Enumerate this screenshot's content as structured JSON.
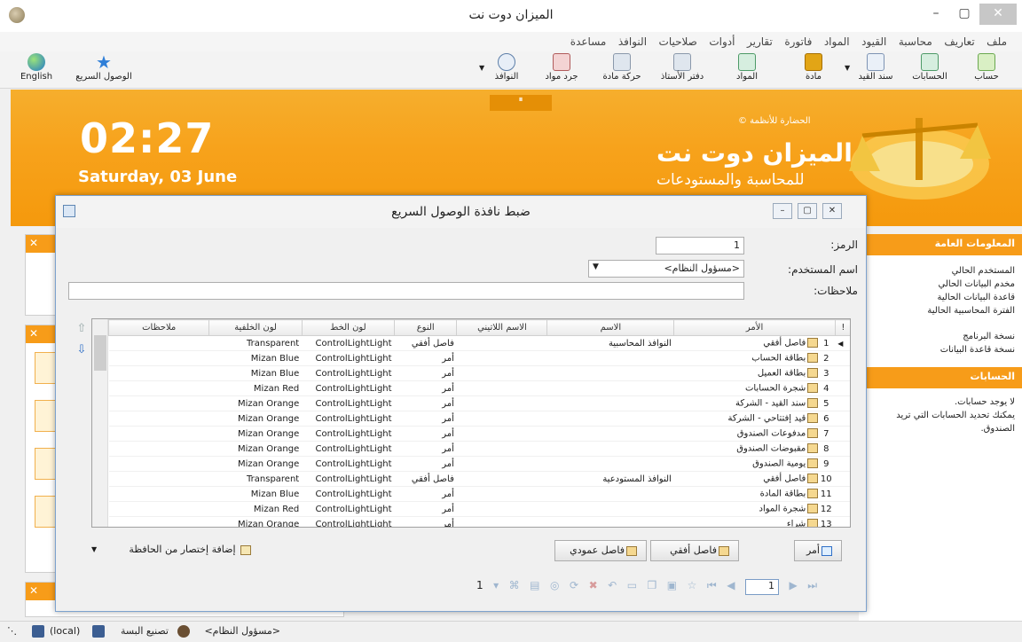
{
  "window": {
    "title": "الميزان دوت نت"
  },
  "menu": [
    "ملف",
    "تعاريف",
    "محاسبة",
    "القيود",
    "المواد",
    "فاتورة",
    "تقارير",
    "أدوات",
    "صلاحيات",
    "النوافذ",
    "مساعدة"
  ],
  "toolbar": {
    "left": [
      {
        "label": "English",
        "icon": "globe-icon"
      },
      {
        "label": "الوصول السريع",
        "icon": "star-icon"
      }
    ],
    "right": [
      {
        "label": "حساب",
        "icon": "account-card-icon"
      },
      {
        "label": "الحسابات",
        "icon": "accounts-tree-icon"
      },
      {
        "label": "سند القيد",
        "icon": "journal-entry-icon"
      },
      {
        "label": "مادة",
        "icon": "material-icon"
      },
      {
        "label": "المواد",
        "icon": "materials-tree-icon"
      },
      {
        "label": "دفتر الأستاذ",
        "icon": "ledger-icon"
      },
      {
        "label": "حركة مادة",
        "icon": "material-movement-icon"
      },
      {
        "label": "جرد مواد",
        "icon": "inventory-icon"
      },
      {
        "label": "النوافذ",
        "icon": "windows-icon"
      }
    ]
  },
  "banner": {
    "time": "02:27",
    "date": "Saturday, 03 June",
    "company": "الحضارة للأنظمة ©",
    "brand": "الميزان دوت نت",
    "tagline": "للمحاسبة والمستودعات",
    "controls": "⏸"
  },
  "right_panel": {
    "general_title": "المعلومات العامة",
    "general_items": [
      "المستخدم الحالي",
      "مخدم البيانات الحالي",
      "قاعدة البيانات الحالية",
      "الفترة المحاسبية الحالية",
      "نسخة البرنامج",
      "نسخة قاعدة البيانات"
    ],
    "accounts_title": "الحسابات",
    "accounts_text1": "لا يوجد حسابات.",
    "accounts_text2": "يمكنك تحديد الحسابات التي تريد",
    "accounts_text3": "الصندوق."
  },
  "dialog": {
    "title": "ضبط نافذة الوصول السريع",
    "code_label": "الرمز:",
    "code_value": "1",
    "user_label": "اسم المستخدم:",
    "user_value": "<مسؤول النظام>",
    "notes_label": "ملاحظات:",
    "notes_value": "",
    "columns": [
      "!",
      "الأمر",
      "الاسم",
      "الاسم اللاتيني",
      "النوع",
      "لون الخط",
      "لون الخلفية",
      "ملاحظات"
    ],
    "rows": [
      {
        "no": "1",
        "cmd": "فاصل أفقي",
        "name": "النوافذ المحاسبية",
        "latin": "",
        "type": "فاصل أفقي",
        "font": "ControlLightLight",
        "bg": "Transparent",
        "notes": "",
        "icon": "horizontal-separator-icon"
      },
      {
        "no": "2",
        "cmd": "بطاقة الحساب",
        "name": "",
        "latin": "",
        "type": "أمر",
        "font": "ControlLightLight",
        "bg": "Mizan Blue",
        "notes": "",
        "icon": "account-card-icon"
      },
      {
        "no": "3",
        "cmd": "بطاقة العميل",
        "name": "",
        "latin": "",
        "type": "أمر",
        "font": "ControlLightLight",
        "bg": "Mizan Blue",
        "notes": "",
        "icon": "customer-icon"
      },
      {
        "no": "4",
        "cmd": "شجرة الحسابات",
        "name": "",
        "latin": "",
        "type": "أمر",
        "font": "ControlLightLight",
        "bg": "Mizan Red",
        "notes": "",
        "icon": "accounts-tree-icon"
      },
      {
        "no": "5",
        "cmd": "سند القيد - الشركة",
        "name": "",
        "latin": "",
        "type": "أمر",
        "font": "ControlLightLight",
        "bg": "Mizan Orange",
        "notes": "",
        "icon": "journal-entry-icon"
      },
      {
        "no": "6",
        "cmd": "قيد إفتتاحي - الشركة",
        "name": "",
        "latin": "",
        "type": "أمر",
        "font": "ControlLightLight",
        "bg": "Mizan Orange",
        "notes": "",
        "icon": "journal-entry-icon"
      },
      {
        "no": "7",
        "cmd": "مدفوعات الصندوق",
        "name": "",
        "latin": "",
        "type": "أمر",
        "font": "ControlLightLight",
        "bg": "Mizan Orange",
        "notes": "",
        "icon": "journal-entry-icon"
      },
      {
        "no": "8",
        "cmd": "مقبوضات الصندوق",
        "name": "",
        "latin": "",
        "type": "أمر",
        "font": "ControlLightLight",
        "bg": "Mizan Orange",
        "notes": "",
        "icon": "journal-entry-icon"
      },
      {
        "no": "9",
        "cmd": "يومية الصندوق",
        "name": "",
        "latin": "",
        "type": "أمر",
        "font": "ControlLightLight",
        "bg": "Mizan Orange",
        "notes": "",
        "icon": "journal-entry-icon"
      },
      {
        "no": "10",
        "cmd": "فاصل أفقي",
        "name": "النوافذ المستودعية",
        "latin": "",
        "type": "فاصل أفقي",
        "font": "ControlLightLight",
        "bg": "Transparent",
        "notes": "",
        "icon": "horizontal-separator-icon"
      },
      {
        "no": "11",
        "cmd": "بطاقة المادة",
        "name": "",
        "latin": "",
        "type": "أمر",
        "font": "ControlLightLight",
        "bg": "Mizan Blue",
        "notes": "",
        "icon": "material-icon"
      },
      {
        "no": "12",
        "cmd": "شجرة المواد",
        "name": "",
        "latin": "",
        "type": "أمر",
        "font": "ControlLightLight",
        "bg": "Mizan Red",
        "notes": "",
        "icon": "materials-tree-icon"
      },
      {
        "no": "13",
        "cmd": "شراء",
        "name": "",
        "latin": "",
        "type": "أمر",
        "font": "ControlLightLight",
        "bg": "Mizan Orange",
        "notes": "",
        "icon": "purchase-icon"
      }
    ],
    "btn_command": "أمر",
    "btn_hsep": "فاصل أفقي",
    "btn_vsep": "فاصل عمودي",
    "btn_paste": "إضافة إختصار من الحافظة",
    "page_label": "1",
    "page_value": "1"
  },
  "status": {
    "user": "<مسؤول النظام>",
    "company": "تصنيع البسة",
    "server": "(local)"
  },
  "colors": {
    "banner_orange": "#f7a21b",
    "panel_header": "#f79c19",
    "dialog_border": "#7da2ce"
  }
}
